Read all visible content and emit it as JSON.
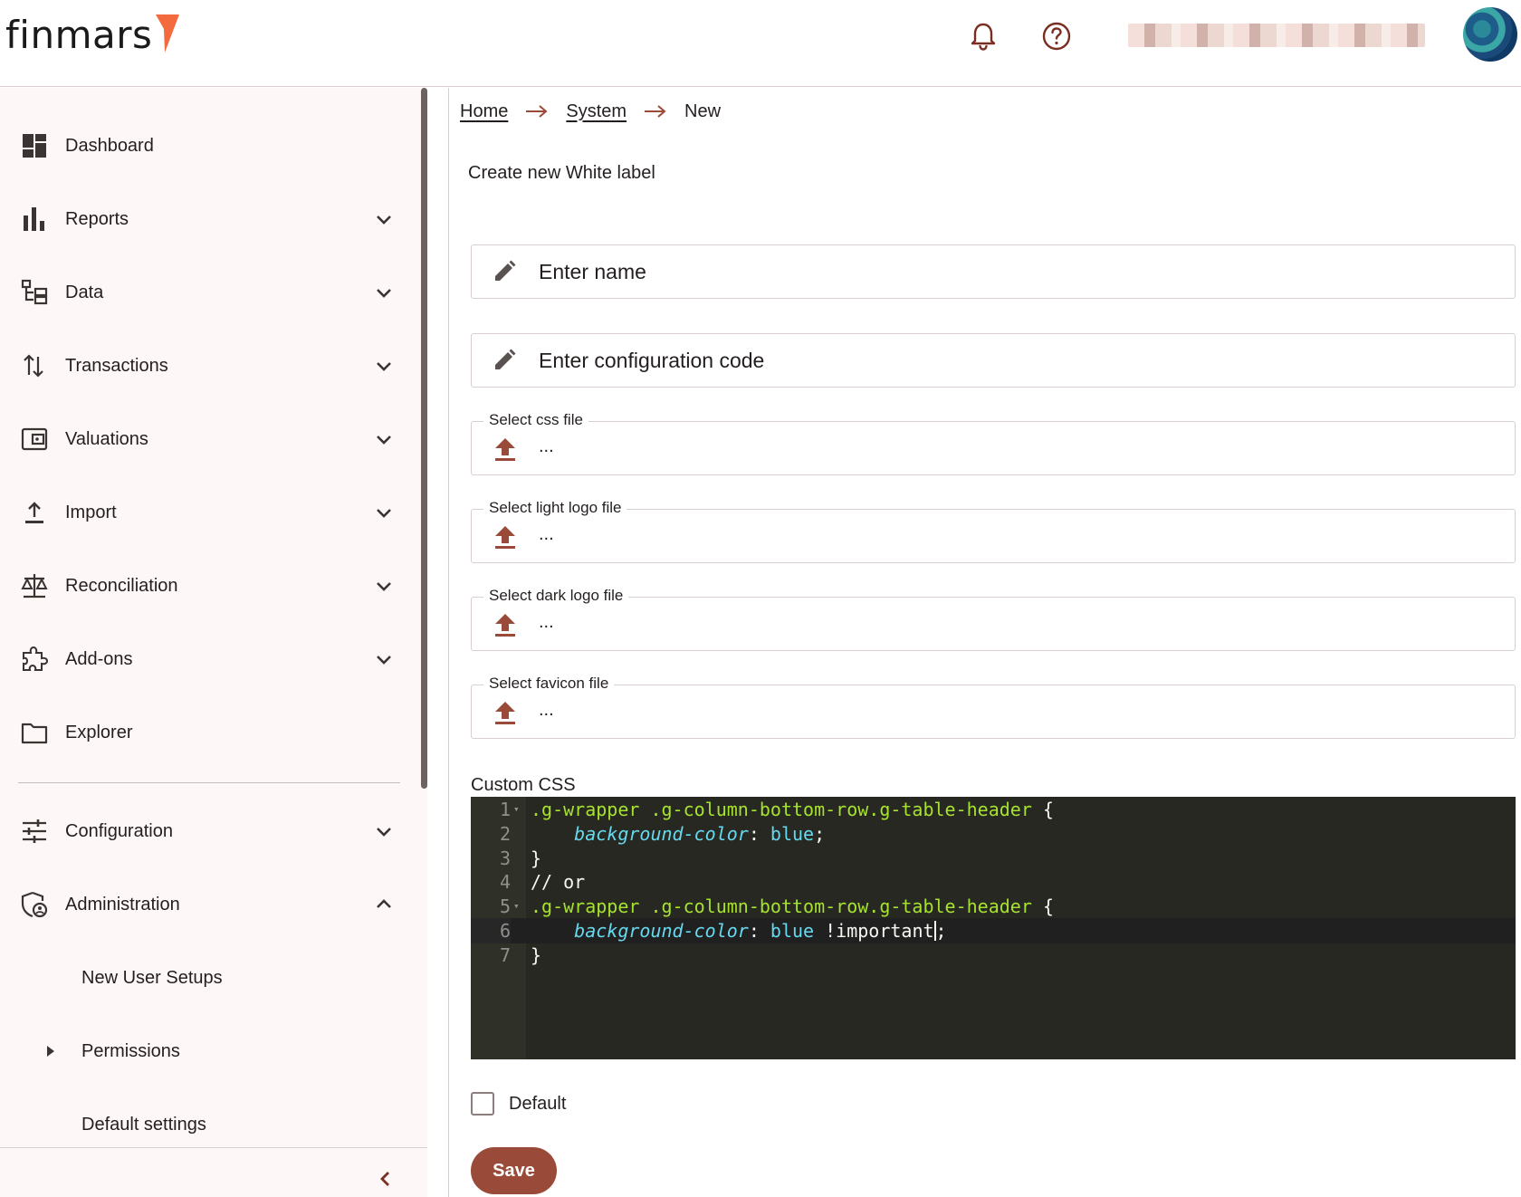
{
  "app": {
    "logo_text": "finmars"
  },
  "header": {
    "bell_icon": "bell-icon",
    "help_icon": "help-circle-icon"
  },
  "sidebar": {
    "items": [
      {
        "label": "Dashboard",
        "icon": "dashboard-icon",
        "expandable": false
      },
      {
        "label": "Reports",
        "icon": "bar-chart-icon",
        "expandable": true
      },
      {
        "label": "Data",
        "icon": "tree-data-icon",
        "expandable": true
      },
      {
        "label": "Transactions",
        "icon": "swap-vertical-icon",
        "expandable": true
      },
      {
        "label": "Valuations",
        "icon": "wallet-icon",
        "expandable": true
      },
      {
        "label": "Import",
        "icon": "upload-icon",
        "expandable": true
      },
      {
        "label": "Reconciliation",
        "icon": "scale-icon",
        "expandable": true
      },
      {
        "label": "Add-ons",
        "icon": "puzzle-icon",
        "expandable": true
      },
      {
        "label": "Explorer",
        "icon": "folder-icon",
        "expandable": false
      },
      {
        "label": "Configuration",
        "icon": "tune-icon",
        "expandable": true
      },
      {
        "label": "Administration",
        "icon": "admin-shield-icon",
        "expandable": true,
        "expanded": true
      }
    ],
    "sub_items": [
      {
        "label": "New User Setups"
      },
      {
        "label": "Permissions",
        "has_children": true
      },
      {
        "label": "Default settings"
      }
    ]
  },
  "breadcrumb": {
    "items": [
      "Home",
      "System"
    ],
    "current": "New"
  },
  "main": {
    "title": "Create new White label",
    "name_placeholder": "Enter name",
    "config_placeholder": "Enter configuration code",
    "files": [
      {
        "label": "Select css file",
        "value": "..."
      },
      {
        "label": "Select light logo file",
        "value": "..."
      },
      {
        "label": "Select dark logo file",
        "value": "..."
      },
      {
        "label": "Select favicon file",
        "value": "..."
      }
    ],
    "custom_css_label": "Custom CSS",
    "code_lines": [
      {
        "n": "1",
        "fold": true,
        "tokens": [
          [
            ".g-wrapper .g-column-bottom-row.g-table-header",
            "sel"
          ],
          [
            " {",
            "plain"
          ]
        ]
      },
      {
        "n": "2",
        "tokens": [
          [
            "    ",
            "plain"
          ],
          [
            "background-color",
            "prop"
          ],
          [
            ": ",
            "plain"
          ],
          [
            "blue",
            "val"
          ],
          [
            ";",
            "plain"
          ]
        ]
      },
      {
        "n": "3",
        "tokens": [
          [
            "}",
            "plain"
          ]
        ]
      },
      {
        "n": "4",
        "tokens": [
          [
            "// or",
            "plain"
          ]
        ]
      },
      {
        "n": "5",
        "fold": true,
        "tokens": [
          [
            ".g-wrapper .g-column-bottom-row.g-table-header",
            "sel"
          ],
          [
            " {",
            "plain"
          ]
        ]
      },
      {
        "n": "6",
        "active": true,
        "tokens": [
          [
            "    ",
            "plain"
          ],
          [
            "background-color",
            "prop"
          ],
          [
            ": ",
            "plain"
          ],
          [
            "blue",
            "val"
          ],
          [
            " !important",
            "plain"
          ],
          [
            "|",
            "cursor"
          ],
          [
            ";",
            "plain"
          ]
        ]
      },
      {
        "n": "7",
        "tokens": [
          [
            "}",
            "plain"
          ]
        ]
      }
    ],
    "default_label": "Default",
    "save_label": "Save"
  },
  "colors": {
    "accent": "#9a4a38",
    "logo_orange": "#f26a3d",
    "editor_bg": "#272822"
  }
}
